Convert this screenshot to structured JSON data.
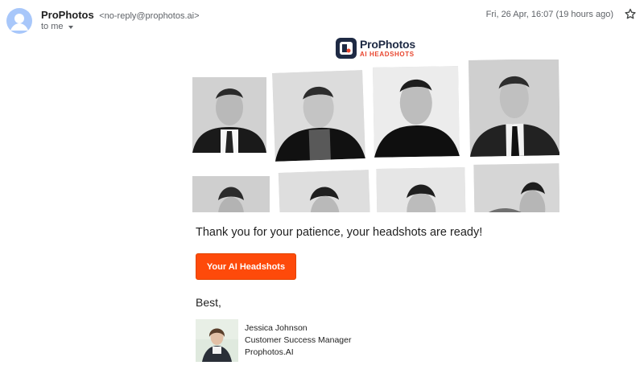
{
  "header": {
    "sender_name": "ProPhotos",
    "sender_email": "<no-reply@prophotos.ai>",
    "to_label": "to me",
    "date": "Fri, 26 Apr, 16:07 (19 hours ago)"
  },
  "logo": {
    "title": "ProPhotos",
    "subtitle": "AI HEADSHOTS"
  },
  "email": {
    "message": "Thank you for your patience, your headshots are ready!",
    "cta_label": "Your AI Headshots",
    "closing": "Best,"
  },
  "signature": {
    "name": "Jessica Johnson",
    "title": "Customer Success Manager",
    "company": "Prophotos.AI"
  },
  "colors": {
    "cta": "#fe4a0a",
    "logo_navy": "#1e2a44",
    "logo_accent": "#e8452e"
  },
  "icons": {
    "avatar": "person-avatar-icon",
    "dropdown": "chevron-down-icon",
    "star": "star-icon",
    "logo": "prophotos-logo-icon"
  }
}
